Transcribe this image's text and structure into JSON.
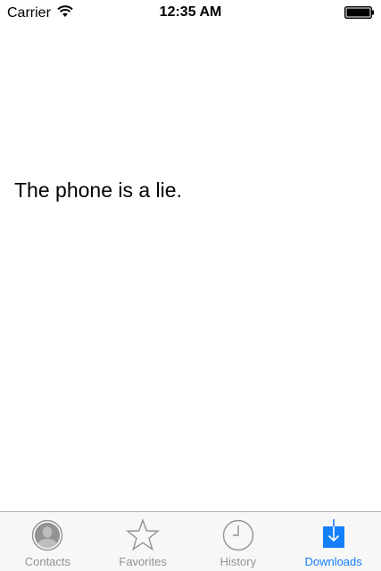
{
  "status_bar": {
    "carrier": "Carrier",
    "time": "12:35 AM",
    "wifi_icon": "wifi-icon",
    "battery_icon": "battery-full-icon"
  },
  "main": {
    "text": "The phone is a lie."
  },
  "tab_bar": {
    "active_color": "#147efb",
    "inactive_color": "#929292",
    "tabs": [
      {
        "label": "Contacts",
        "icon": "contacts-icon",
        "active": false
      },
      {
        "label": "Favorites",
        "icon": "star-icon",
        "active": false
      },
      {
        "label": "History",
        "icon": "clock-icon",
        "active": false
      },
      {
        "label": "Downloads",
        "icon": "download-icon",
        "active": true
      }
    ]
  }
}
